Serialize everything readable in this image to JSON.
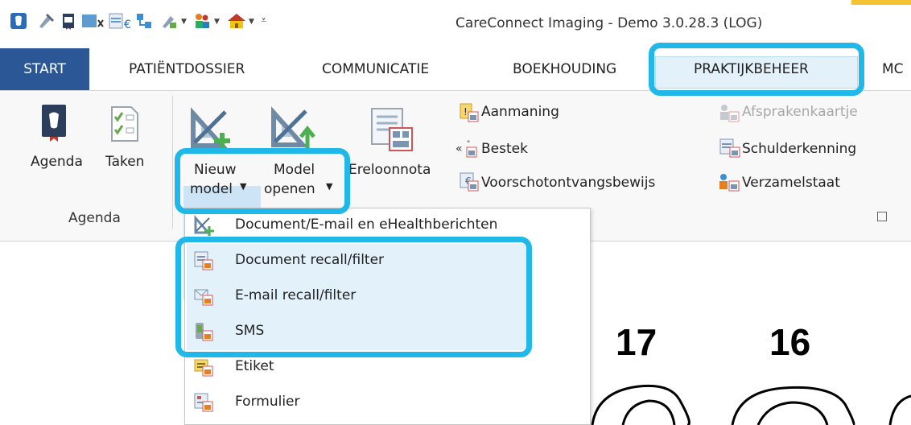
{
  "window": {
    "title": "CareConnect Imaging - Demo 3.0.28.3 (LOG)"
  },
  "quick_access": [
    "app-icon",
    "tools-icon",
    "book-icon",
    "xray-icon",
    "invoice-icon",
    "network-icon",
    "tools2-icon",
    "people-icon",
    "home-icon",
    "customize-icon"
  ],
  "tabs": [
    {
      "label": "START",
      "active": true
    },
    {
      "label": "PATIËNTDOSSIER"
    },
    {
      "label": "COMMUNICATIE"
    },
    {
      "label": "BOEKHOUDING"
    },
    {
      "label": "PRAKTIJKBEHEER",
      "highlighted": true
    },
    {
      "label": "MC"
    }
  ],
  "ribbon": {
    "agenda_label": "Agenda",
    "taken_label": "Taken",
    "nieuw_line1": "Nieuw",
    "nieuw_line2": "model",
    "model_line1": "Model",
    "model_line2": "openen",
    "ereloonnota_label": "Ereloonnota",
    "small_items": [
      "Aanmaning",
      "Bestek",
      "Voorschotontvangsbewijs",
      "Afsprakenkaartje",
      "Schulderkenning",
      "Verzamelstaat"
    ],
    "group_agenda": "Agenda"
  },
  "dropdown": {
    "items": [
      "Document/E-mail en eHealthberichten",
      "Document recall/filter",
      "E-mail recall/filter",
      "SMS",
      "Etiket",
      "Formulier"
    ]
  },
  "chart": {
    "tooth_17": "17",
    "tooth_16": "16"
  },
  "colors": {
    "highlight": "#1fb8e8",
    "start_tab": "#2b5797",
    "selection": "#e3f1fb"
  }
}
